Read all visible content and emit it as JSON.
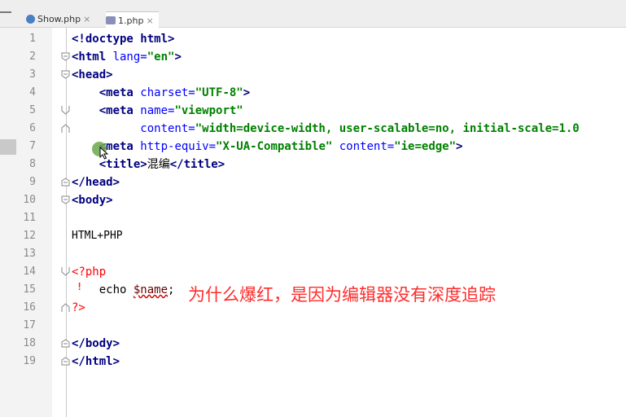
{
  "tabs": [
    {
      "label": "Show.php",
      "close": "×"
    },
    {
      "label": "1.php",
      "close": "×"
    }
  ],
  "lines": [
    {
      "num": "1"
    },
    {
      "num": "2"
    },
    {
      "num": "3"
    },
    {
      "num": "4"
    },
    {
      "num": "5"
    },
    {
      "num": "6"
    },
    {
      "num": "7"
    },
    {
      "num": "8"
    },
    {
      "num": "9"
    },
    {
      "num": "10"
    },
    {
      "num": "11"
    },
    {
      "num": "12"
    },
    {
      "num": "13"
    },
    {
      "num": "14"
    },
    {
      "num": "15"
    },
    {
      "num": "16"
    },
    {
      "num": "17"
    },
    {
      "num": "18"
    },
    {
      "num": "19"
    }
  ],
  "code": {
    "l1": "<!doctype html>",
    "l2a": "<html ",
    "l2b": "lang=",
    "l2c": "\"en\"",
    "l2d": ">",
    "l3": "<head>",
    "l4a": "    <meta ",
    "l4b": "charset=",
    "l4c": "\"UTF-8\"",
    "l4d": ">",
    "l5a": "    <meta ",
    "l5b": "name=",
    "l5c": "\"viewport\"",
    "l6a": "          content=",
    "l6b": "\"width=device-width, user-scalable=no, initial-scale=1.0",
    "l7a": "    <meta ",
    "l7b": "http-equiv=",
    "l7c": "\"X-UA-Compatible\"",
    "l7d": " content=",
    "l7e": "\"ie=edge\"",
    "l7f": ">",
    "l8a": "    <title>",
    "l8b": "混编",
    "l8c": "</title>",
    "l9": "</head>",
    "l10": "<body>",
    "l12": "HTML+PHP",
    "l14": "<?php",
    "l15a": "    echo ",
    "l15b": "$name",
    "l15c": ";",
    "l16": "?>",
    "l18": "</body>",
    "l19": "</html>"
  },
  "annotation": "为什么爆红，是因为编辑器没有深度追踪",
  "error_marker": "!"
}
